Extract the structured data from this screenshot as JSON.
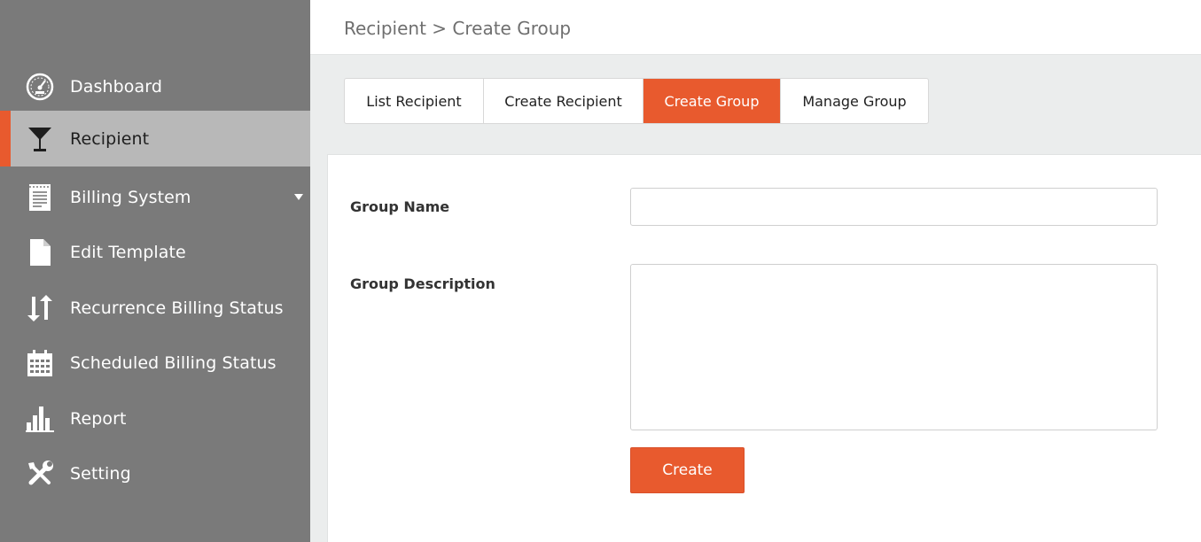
{
  "breadcrumb": "Recipient > Create Group",
  "sidebar": {
    "items": [
      {
        "label": "Dashboard",
        "icon": "dashboard-gauge-icon"
      },
      {
        "label": "Recipient",
        "icon": "cocktail-glass-icon",
        "active": true
      },
      {
        "label": "Billing System",
        "icon": "document-lines-icon",
        "has_submenu": true
      },
      {
        "label": "Edit Template",
        "icon": "file-icon"
      },
      {
        "label": "Recurrence Billing Status",
        "icon": "sort-arrows-icon"
      },
      {
        "label": "Scheduled Billing Status",
        "icon": "calendar-icon"
      },
      {
        "label": "Report",
        "icon": "bar-chart-icon"
      },
      {
        "label": "Setting",
        "icon": "tools-icon"
      }
    ]
  },
  "tabs": [
    {
      "label": "List Recipient"
    },
    {
      "label": "Create Recipient"
    },
    {
      "label": "Create Group",
      "active": true
    },
    {
      "label": "Manage Group"
    }
  ],
  "form": {
    "group_name_label": "Group Name",
    "group_name_value": "",
    "group_description_label": "Group Description",
    "group_description_value": "",
    "submit_label": "Create"
  },
  "colors": {
    "accent": "#e85a2e",
    "sidebar_bg": "#7a7a7a",
    "sidebar_active_bg": "#b8b8b8",
    "content_bg": "#ebeded"
  }
}
